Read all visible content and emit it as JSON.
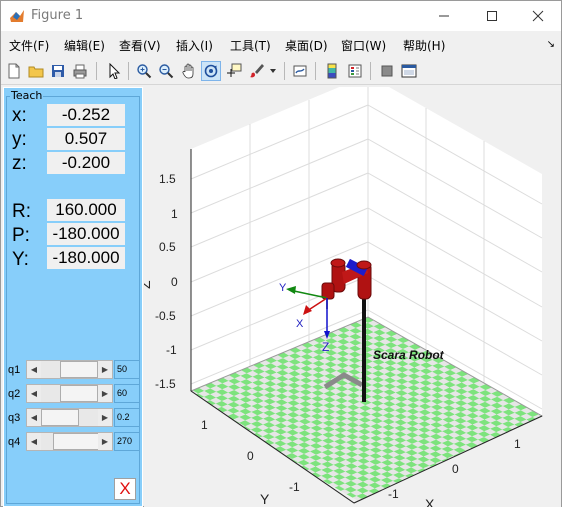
{
  "window": {
    "title": "Figure 1"
  },
  "menu": [
    "文件(F)",
    "编辑(E)",
    "查看(V)",
    "插入(I)",
    "工具(T)",
    "桌面(D)",
    "窗口(W)",
    "帮助(H)"
  ],
  "teach": {
    "title": "Teach",
    "pos": [
      {
        "label": "x:",
        "value": "-0.252"
      },
      {
        "label": "y:",
        "value": "0.507"
      },
      {
        "label": "z:",
        "value": "-0.200"
      }
    ],
    "rpy": [
      {
        "label": "R:",
        "value": "160.000"
      },
      {
        "label": "P:",
        "value": "-180.000"
      },
      {
        "label": "Y:",
        "value": "-180.000"
      }
    ],
    "joints": [
      {
        "label": "q1",
        "value": "50"
      },
      {
        "label": "q2",
        "value": "60"
      },
      {
        "label": "q3",
        "value": "0.2"
      },
      {
        "label": "q4",
        "value": "270"
      }
    ],
    "close_label": "X"
  },
  "plot": {
    "z_ticks": [
      "1.5",
      "1",
      "0.5",
      "0",
      "-0.5",
      "-1",
      "-1.5"
    ],
    "y_ticks": [
      "1",
      "0",
      "-1"
    ],
    "x_ticks": [
      "1",
      "0",
      "-1"
    ],
    "xlabel": "X",
    "ylabel": "Y",
    "zlabel": "Z",
    "robot_name": "Scara Robot",
    "frame_labels": {
      "x": "X",
      "y": "Y",
      "z": "Z"
    }
  }
}
